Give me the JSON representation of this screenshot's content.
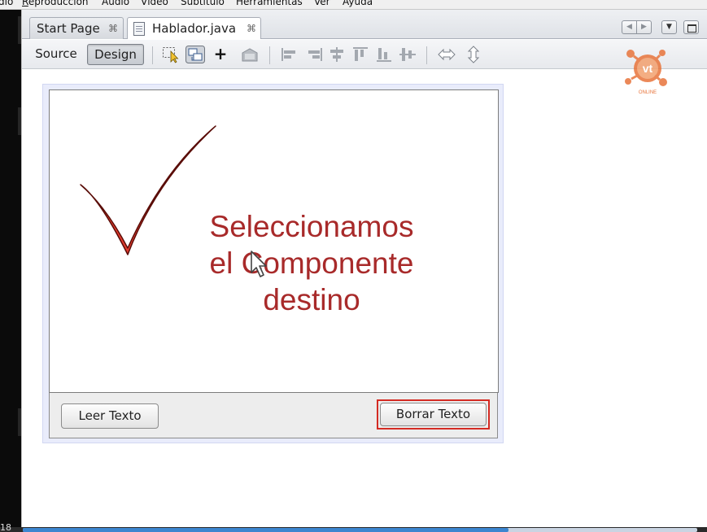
{
  "menu": {
    "items": [
      {
        "label": "dio"
      },
      {
        "label": "Reproducción"
      },
      {
        "label": "Audio"
      },
      {
        "label": "Vídeo"
      },
      {
        "label": "Subtítulo"
      },
      {
        "label": "Herramientas"
      },
      {
        "label": "Ver"
      },
      {
        "label": "Ayuda"
      }
    ]
  },
  "tabs": {
    "start_page": "Start Page",
    "hablador": "Hablador.java",
    "close_glyph": "⌘"
  },
  "toolbar": {
    "source_label": "Source",
    "design_label": "Design",
    "add_glyph": "+"
  },
  "logo": {
    "initials": "vt",
    "subtitle": "ONLINE",
    "color": "#e8743b"
  },
  "form": {
    "leer_label": "Leer Texto",
    "borrar_label": "Borrar Texto",
    "highlight_color": "#d42b23"
  },
  "annotation": {
    "lines": [
      "Seleccionamos",
      "el Componente",
      "destino"
    ],
    "color": "#a82a2a"
  },
  "playback": {
    "time_stub": "18",
    "progress_fraction": 0.72
  }
}
